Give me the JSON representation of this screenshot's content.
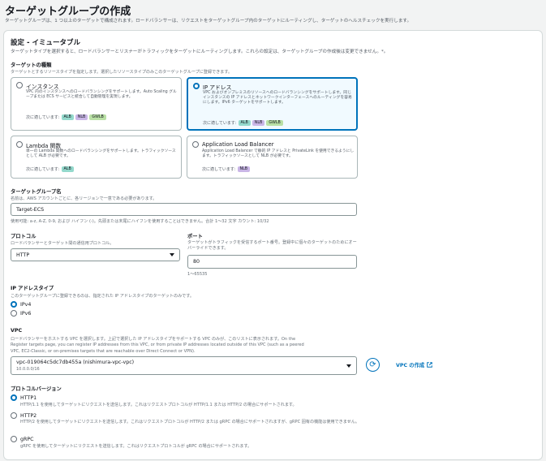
{
  "page": {
    "title": "ターゲットグループの作成",
    "subtitle": "ターゲットグループは、1 つ以上のターゲットで構成されます。ロードバランサーは、リクエストをターゲットグループ内のターゲットにルーティングし、ターゲットのヘルスチェックを実行します。"
  },
  "settings": {
    "title": "設定 - イミュータブル",
    "description": "ターゲットタイプを選択すると、ロードバランサーとリスナーがトラフィックをターゲットにルーティングします。これらの設定は、ターゲットグループの作成後は変更できません。*。",
    "target_type": {
      "label": "ターゲットの種類",
      "description": "ターゲットとするリソースタイプを指定します。選択したリソースタイプのみこのターゲットグループに登録できます。",
      "fits_label": "次に適しています:",
      "options": [
        {
          "title": "インスタンス",
          "desc": "VPC 内のインスタンスへのロードバランシングをサポートします。Auto Scaling グループまたは ECS サービスと統合して自動管理を実現します。",
          "badges": [
            "ALB",
            "NLB",
            "GWLB"
          ],
          "selected": false
        },
        {
          "title": "IP アドレス",
          "desc": "VPC およびオンプレミスのリソースへのロードバランシングをサポートします。同じインスタンスの IP アドレスとネットワークインターフェースへのルーティングを容易にします。IPv6 ターゲットをサポートします。",
          "badges": [
            "ALB",
            "NLB",
            "GWLB"
          ],
          "selected": true
        },
        {
          "title": "Lambda 関数",
          "desc": "単一の Lambda 関数へのロードバランシングをサポートします。トラフィックソースとして ALB が必要です。",
          "badges": [
            "ALB"
          ],
          "selected": false
        },
        {
          "title": "Application Load Balancer",
          "desc": "Application Load Balancer で静的 IP アドレスと PrivateLink を使用できるようにします。トラフィックソースとして NLB が必要です。",
          "badges": [
            "NLB"
          ],
          "selected": false
        }
      ]
    },
    "target_group_name": {
      "label": "ターゲットグループ名",
      "description": "名前は、AWS アカウントごとに、各リージョンで一意である必要があります。",
      "value": "Target-ECS",
      "hint": "使用可能: a-z, A-Z, 0-9, および ハイフン (-)。先頭または末尾にハイフンを使用することはできません。合計 1〜32 文字 カウント: 10/32"
    },
    "protocol": {
      "label": "プロトコル",
      "description": "ロードバランサーとターゲット間の通信用プロトコル。",
      "value": "HTTP"
    },
    "port": {
      "label": "ポート",
      "description": "ターゲットがトラフィックを受信するポート番号。登録中に個々のターゲットのためにオーバーライドできます。",
      "value": "80",
      "hint": "1〜65535"
    },
    "ip_address_type": {
      "label": "IP アドレスタイプ",
      "description": "このターゲットグループに登録できるのは、指定された IP アドレスタイプのターゲットのみです。",
      "options": [
        {
          "label": "IPv4",
          "selected": true
        },
        {
          "label": "IPv6",
          "selected": false
        }
      ]
    },
    "vpc": {
      "label": "VPC",
      "description_line1": "ロードバランサーをホストする VPC を選択します。上記で選択した IP アドレスタイプをサポートする VPC のみが、このリストに表示されます。On the",
      "description_line2": "Register targets page, you can register IP addresses from this VPC, or from private IP addresses located outside of this VPC (such as a peered",
      "description_line3": "VPC, EC2-Classic, or on-premises targets that are reachable over Direct Connect or VPN).",
      "selected_value": "vpc-019064c5dc7db455a (nishimura-vpc-vpc)",
      "selected_cidr": "10.0.0.0/16",
      "create_link": "VPC の作成"
    },
    "protocol_version": {
      "label": "プロトコルバージョン",
      "options": [
        {
          "label": "HTTP1",
          "desc": "HTTP/1.1 を使用してターゲットにリクエストを送信します。これはリクエストプロトコルが HTTP/1.1 または HTTP/2 の場合にサポートされます。",
          "selected": true
        },
        {
          "label": "HTTP2",
          "desc": "HTTP/2 を使用してターゲットにリクエストを送信します。これはリクエストプロトコルが HTTP/2 または gRPC の場合にサポートされますが、gRPC 固有の機能は使用できません。",
          "selected": false
        },
        {
          "label": "gRPC",
          "desc": "gRPC を使用してターゲットにリクエストを送信します。これはリクエストプロトコルが gRPC の場合にサポートされます。",
          "selected": false
        }
      ]
    }
  }
}
